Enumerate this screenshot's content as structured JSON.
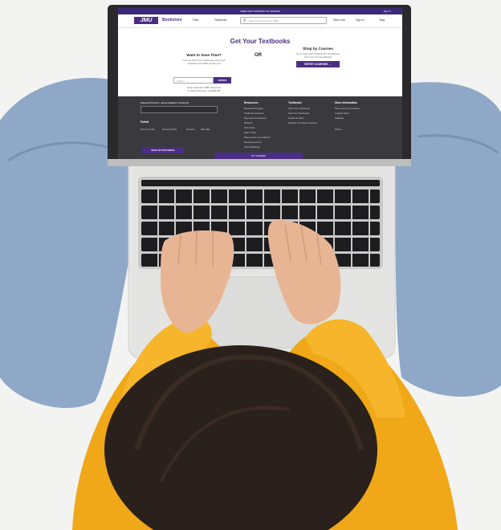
{
  "screen": {
    "topbar_text": "FREE SHIP SHIPPING ON ORDERS",
    "account_text": "Sign In",
    "logo": "JMU",
    "brand": "Bookstore",
    "nav": [
      "Files",
      "Textbooks",
      "Store Info",
      "Sign In",
      "Bag"
    ],
    "search_placeholder": "Search by keyword or ISBN",
    "hero_title": "Get Your Textbooks",
    "left_title": "Want to Save Time?",
    "left_sub": [
      "Look up all of your textbooks using your",
      "schedule and ISBN search tool"
    ],
    "isbn_placeholder": "ISBN #",
    "enter_label": "ENTER",
    "left_note": [
      "Enter Students' ISBN Searched",
      "for Book Example: 123456789"
    ],
    "or_label": "OR",
    "right_title": "Shop by Courses",
    "right_sub": [
      "Don't have your Student ID? Find Books",
      "Find your Courses Below!"
    ],
    "courses_label": "ENTER COURSES →",
    "footer": {
      "select_label": "Selected Precinct: James Madison University",
      "follett": "Follett",
      "links": [
        "Terms of Use",
        "Privacy Policy",
        "Careers",
        "Site Map"
      ],
      "col1_title": "Resources",
      "col1": [
        "Rewards Program",
        "Textbook Services",
        "Payment & Financial",
        "Returns",
        "Gift Cards",
        "Help / FAQ",
        "Store Hours & Locations",
        "Tax Exempt Info",
        "Price Matching",
        "Store Events"
      ],
      "col2_title": "Textbooks",
      "col2": [
        "Find Your Textbooks",
        "Sell Your Textbooks",
        "Textbook FAQ",
        "Register for Class Courses"
      ],
      "col3_title": "Store Information",
      "col3": [
        "Store Hours & Location",
        "Contact Store",
        "Address",
        "Phone"
      ],
      "signup_label": "SIGN UP FOR EMAIL",
      "bottom_bar": "MY ORDERS"
    }
  },
  "colors": {
    "brand_purple": "#4b2e83",
    "sweater": "#f0a818",
    "jeans": "#8fa8c8",
    "laptop": "#e4e4e2"
  }
}
